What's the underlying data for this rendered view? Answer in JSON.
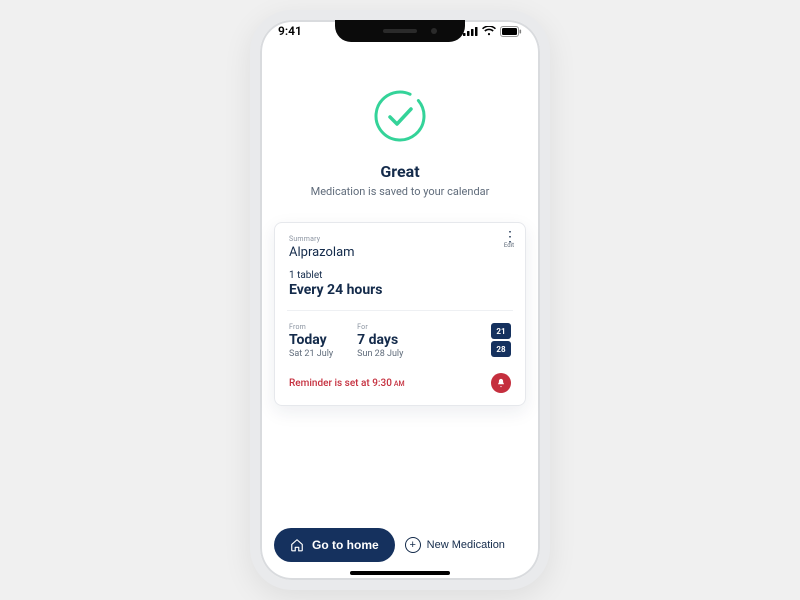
{
  "status": {
    "time": "9:41"
  },
  "hero": {
    "title": "Great",
    "subtitle": "Medication is saved to your calendar"
  },
  "card": {
    "summary_label": "Summary",
    "medication_name": "Alprazolam",
    "dose": "1 tablet",
    "frequency": "Every 24 hours",
    "from_label": "From",
    "from_main": "Today",
    "from_sub": "Sat 21 July",
    "for_label": "For",
    "for_main": "7 days",
    "for_sub": "Sun 28 July",
    "cal_start": "21",
    "cal_end": "28",
    "reminder_prefix": "Reminder is set at ",
    "reminder_time": "9:30",
    "reminder_ampm": "AM",
    "edit_label": "Edit"
  },
  "actions": {
    "primary": "Go to home",
    "secondary": "New Medication"
  }
}
